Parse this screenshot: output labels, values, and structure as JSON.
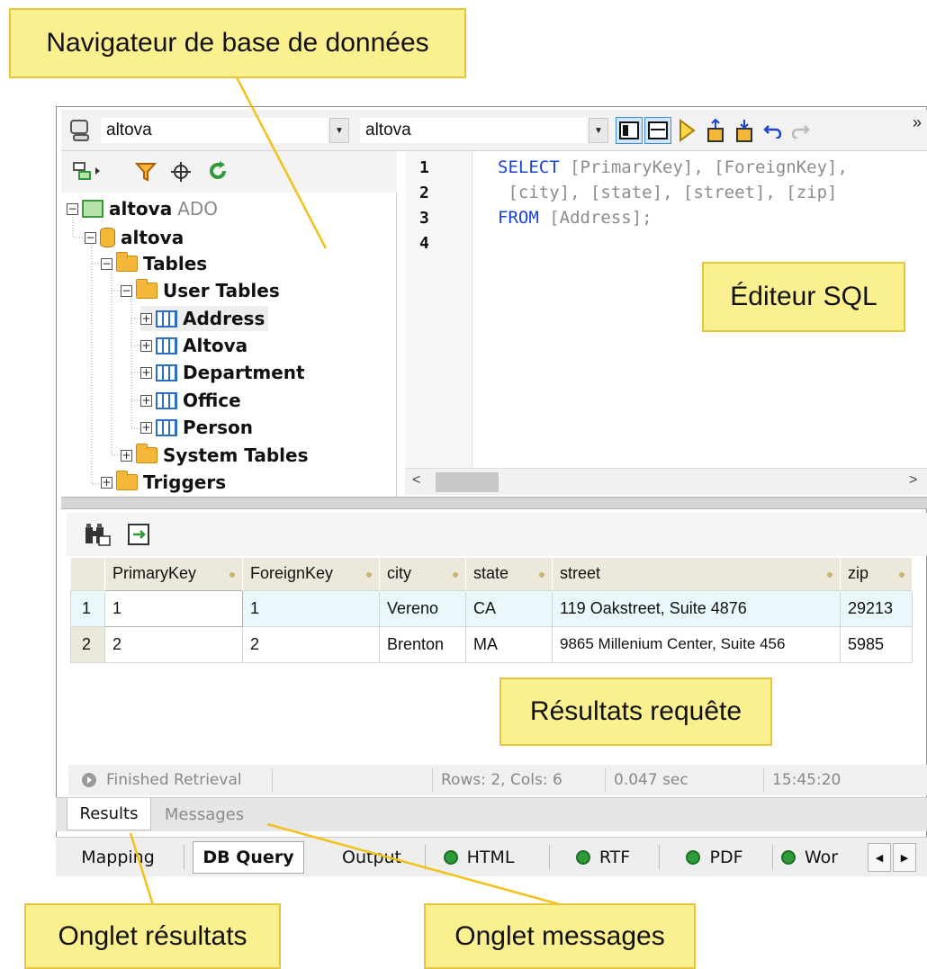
{
  "callouts": {
    "navigator": "Navigateur de base de données",
    "sql_editor": "Éditeur SQL",
    "query_results": "Résultats requête",
    "results_tab": "Onglet résultats",
    "messages_tab": "Onglet messages"
  },
  "toolbar": {
    "datasource": "altova",
    "root_object": "altova",
    "icons": [
      "datasource-icon",
      "layout-single-icon",
      "layout-split-icon",
      "execute-icon",
      "export-icon",
      "import-icon",
      "undo-icon",
      "redo-icon"
    ],
    "overflow": "»"
  },
  "navigator": {
    "tools": [
      "add-datasource-icon",
      "filter-icon",
      "locate-icon",
      "refresh-icon"
    ],
    "tree": {
      "connection": {
        "name": "altova",
        "type": "ADO"
      },
      "database": "altova",
      "tables_folder": "Tables",
      "user_tables_folder": "User Tables",
      "user_tables": [
        "Address",
        "Altova",
        "Department",
        "Office",
        "Person"
      ],
      "system_tables_folder": "System Tables",
      "triggers_folder": "Triggers"
    }
  },
  "editor": {
    "line_numbers": [
      "1",
      "2",
      "3",
      "4"
    ],
    "lines": [
      [
        {
          "kind": "kw",
          "text": "SELECT "
        },
        {
          "kind": "id",
          "text": "[PrimaryKey], [ForeignKey],"
        }
      ],
      [
        {
          "kind": "id",
          "text": " [city], [state], [street], [zip]"
        }
      ],
      [
        {
          "kind": "kw",
          "text": "FROM "
        },
        {
          "kind": "id",
          "text": "[Address];"
        }
      ],
      []
    ]
  },
  "results": {
    "tools": [
      "find-icon",
      "goto-icon"
    ],
    "columns": [
      "PrimaryKey",
      "ForeignKey",
      "city",
      "state",
      "street",
      "zip"
    ],
    "rows": [
      {
        "num": "1",
        "cells": [
          "1",
          "1",
          "Vereno",
          "CA",
          "119 Oakstreet, Suite 4876",
          "29213"
        ]
      },
      {
        "num": "2",
        "cells": [
          "2",
          "2",
          "Brenton",
          "MA",
          "9865 Millenium Center, Suite 456",
          "5985"
        ]
      }
    ],
    "status": {
      "state": "Finished Retrieval",
      "rows_cols": "Rows: 2, Cols: 6",
      "duration": "0.047 sec",
      "time": "15:45:20"
    },
    "tabs": {
      "results": "Results",
      "messages": "Messages"
    }
  },
  "bottom_tabs": [
    {
      "label": "Mapping",
      "icon": false,
      "active": false
    },
    {
      "label": "DB Query",
      "icon": false,
      "active": true
    },
    {
      "label": "Output",
      "icon": false,
      "active": false
    },
    {
      "label": "HTML",
      "icon": true,
      "active": false
    },
    {
      "label": "RTF",
      "icon": true,
      "active": false
    },
    {
      "label": "PDF",
      "icon": true,
      "active": false
    },
    {
      "label": "Wor",
      "icon": true,
      "active": false
    }
  ],
  "colors": {
    "callout_fill": "#fbf08f",
    "callout_border": "#e8c53a",
    "keyword": "#1a44d6",
    "identifier": "#8c8c8c",
    "status_ok": "#2e9b3a"
  }
}
